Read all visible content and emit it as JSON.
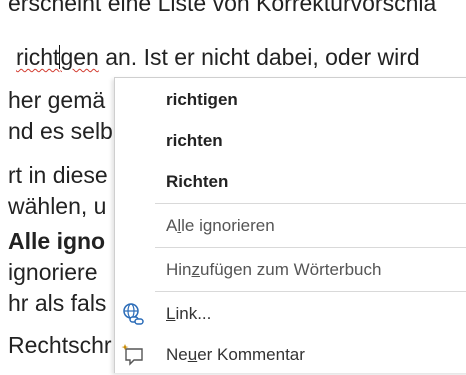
{
  "document": {
    "line1": "erscheint eine Liste von Korrekturvorschlä",
    "line2_pre": "richt",
    "line2_post": "gen",
    "line2_rest": " an. Ist er nicht dabei, oder wird",
    "line3": "her gemä",
    "line4": "nd es selb",
    "line5": "rt in diese",
    "line6": "wählen, u",
    "line7_bold": "Alle igno",
    "line8": "ignoriere",
    "line9": "hr als fals",
    "line10": "Rechtschr"
  },
  "context_menu": {
    "suggestions": [
      "richtigen",
      "richten",
      "Richten"
    ],
    "ignore_all": {
      "pre": "A",
      "accel": "l",
      "post": "le ignorieren"
    },
    "add_to_dictionary": {
      "pre": "Hin",
      "accel": "z",
      "post": "ufügen zum Wörterbuch"
    },
    "link": {
      "pre": "",
      "accel": "L",
      "post": "ink..."
    },
    "new_comment": {
      "pre": "Ne",
      "accel": "u",
      "post": "er Kommentar"
    },
    "icons": {
      "link": "link-globe-icon",
      "comment": "new-comment-icon"
    },
    "colors": {
      "misspelling_underline": "#d23b2f",
      "link_icon": "#2b6cb8",
      "comment_icon": "#c98a00"
    }
  }
}
